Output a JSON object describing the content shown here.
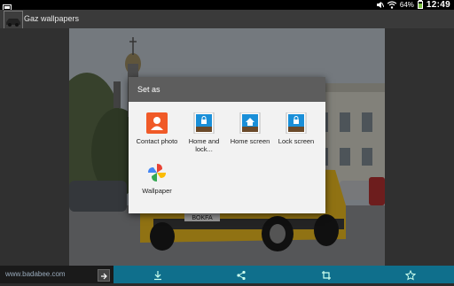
{
  "status_bar": {
    "battery_percent": "64%",
    "time": "12:49",
    "icons": [
      "screenshot-icon",
      "mute-icon",
      "wifi-icon",
      "battery-icon"
    ]
  },
  "action_bar": {
    "app_icon": "app-car-icon",
    "title": "Gaz wallpapers"
  },
  "dialog": {
    "title": "Set as",
    "options": [
      {
        "label": "Contact photo",
        "icon": "contact-icon"
      },
      {
        "label": "Home and lock...",
        "icon": "home-lock-icon"
      },
      {
        "label": "Home screen",
        "icon": "home-screen-icon"
      },
      {
        "label": "Lock screen",
        "icon": "lock-screen-icon"
      },
      {
        "label": "Wallpaper",
        "icon": "wallpaper-pinwheel-icon"
      }
    ]
  },
  "bottom_bar": {
    "ad_text": "www.badabee.com",
    "actions": [
      "download-icon",
      "share-icon",
      "crop-icon",
      "favorite-star-icon"
    ]
  },
  "photo": {
    "plate_text": "BOKFA"
  },
  "colors": {
    "bottom_bar": "#0f6f8c",
    "dialog_header": "#5d5d5d",
    "contact_orange": "#f05a28",
    "screen_blue": "#1a8fd8"
  }
}
